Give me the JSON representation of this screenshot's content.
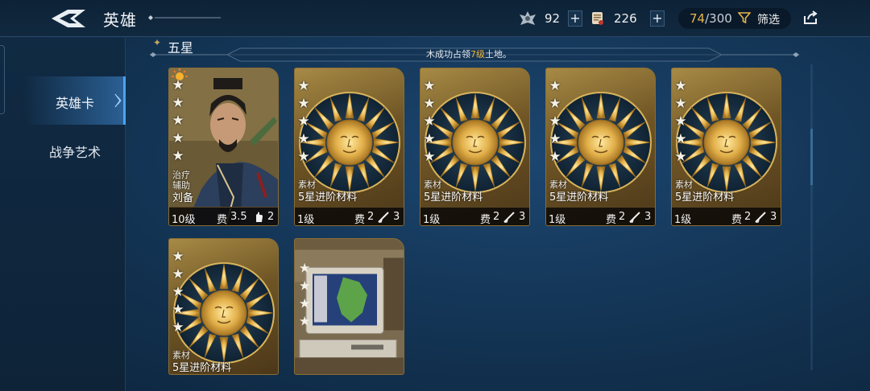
{
  "header": {
    "title": "英雄",
    "resource1": {
      "icon": "hero-emblem-icon",
      "value": "92"
    },
    "resource2": {
      "icon": "scroll-icon",
      "value": "226"
    },
    "plus_label": "+",
    "count_current": "74",
    "count_total": "/300",
    "filter_label": "筛选"
  },
  "sidebar": {
    "tabs": [
      {
        "label": "英雄卡",
        "active": true
      },
      {
        "label": "战争艺术",
        "active": false
      }
    ]
  },
  "section": {
    "title": "五星",
    "notice_prefix": "木成功占领",
    "notice_highlight": "7级",
    "notice_suffix": "土地。"
  },
  "cards": [
    {
      "kind": "hero",
      "stars": 5,
      "type1": "治疗",
      "type2": "辅助",
      "name": "刘备",
      "level": "10级",
      "cost_label": "费",
      "cost": "3.5",
      "extra": "2"
    },
    {
      "kind": "material",
      "stars": 5,
      "type1": "素材",
      "name": "5星进阶材料",
      "level": "1级",
      "cost_label": "费",
      "cost": "2",
      "extra": "3"
    },
    {
      "kind": "material",
      "stars": 5,
      "type1": "素材",
      "name": "5星进阶材料",
      "level": "1级",
      "cost_label": "费",
      "cost": "2",
      "extra": "3"
    },
    {
      "kind": "material",
      "stars": 5,
      "type1": "素材",
      "name": "5星进阶材料",
      "level": "1级",
      "cost_label": "费",
      "cost": "2",
      "extra": "3"
    },
    {
      "kind": "material",
      "stars": 5,
      "type1": "素材",
      "name": "5星进阶材料",
      "level": "1级",
      "cost_label": "费",
      "cost": "2",
      "extra": "3"
    },
    {
      "kind": "material",
      "stars": 5,
      "type1": "素材",
      "name": "5星进阶材料"
    },
    {
      "kind": "photo",
      "stars": 5
    }
  ],
  "colors": {
    "accent_gold": "#e8b64a",
    "active_tab": "#4da3ef",
    "highlight": "#f2b53a"
  }
}
